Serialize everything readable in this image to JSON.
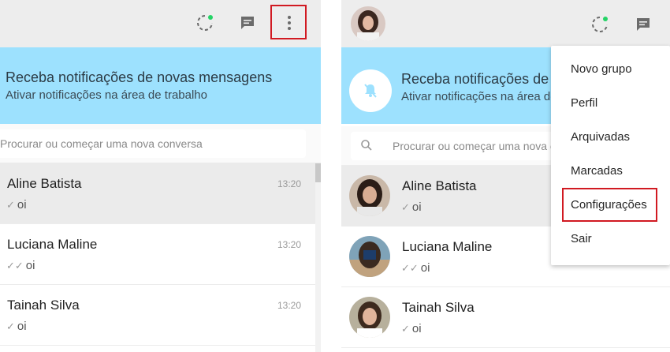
{
  "left": {
    "notification": {
      "title": "Receba notificações de novas mensagens",
      "subtitle": "Ativar notificações na área de trabalho"
    },
    "search": {
      "placeholder": "Procurar ou começar uma nova conversa"
    },
    "chats": [
      {
        "name": "Aline Batista",
        "time": "13:20",
        "message": "oi",
        "tick": "✓"
      },
      {
        "name": "Luciana Maline",
        "time": "13:20",
        "message": "oi",
        "tick": "✓✓"
      },
      {
        "name": "Tainah Silva",
        "time": "13:20",
        "message": "oi",
        "tick": "✓"
      }
    ]
  },
  "right": {
    "notification": {
      "title": "Receba notificações de n",
      "subtitle": "Ativar notificações na área de"
    },
    "search": {
      "placeholder": "Procurar ou começar uma nova c"
    },
    "chats": [
      {
        "name": "Aline Batista",
        "message": "oi",
        "tick": "✓"
      },
      {
        "name": "Luciana Maline",
        "message": "oi",
        "tick": "✓✓"
      },
      {
        "name": "Tainah Silva",
        "message": "oi",
        "tick": "✓"
      }
    ],
    "menu": {
      "items": [
        "Novo grupo",
        "Perfil",
        "Arquivadas",
        "Marcadas",
        "Configurações",
        "Sair"
      ]
    }
  },
  "icons": {
    "status": "status-icon",
    "new_chat": "new-chat-icon",
    "menu": "menu-icon",
    "bell_off": "bell-off-icon",
    "search": "search-icon"
  },
  "colors": {
    "header_bg": "#ededed",
    "notification_bg": "#9de1fe",
    "highlight": "#d11a22",
    "status_accent": "#25d366",
    "active_row": "#ebebeb"
  }
}
